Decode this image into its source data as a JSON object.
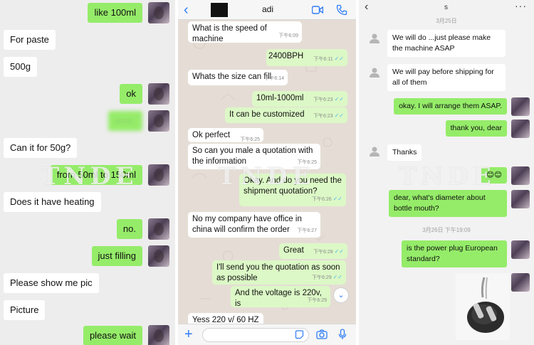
{
  "panel1": {
    "messages": [
      {
        "dir": "out",
        "text": "like 100ml"
      },
      {
        "dir": "in",
        "text": "For paste"
      },
      {
        "dir": "in",
        "text": "500g"
      },
      {
        "dir": "out",
        "text": "ok"
      },
      {
        "dir": "out",
        "text": "——",
        "blurred": true
      },
      {
        "dir": "in",
        "text": "Can it for 50g?"
      },
      {
        "dir": "out",
        "text": "from 50ml to 150ml"
      },
      {
        "dir": "in",
        "text": "Does it have heating"
      },
      {
        "dir": "out",
        "text": "no."
      },
      {
        "dir": "out",
        "text": "just filling"
      },
      {
        "dir": "in",
        "text": "Please show me pic"
      },
      {
        "dir": "in",
        "text": "Picture"
      },
      {
        "dir": "out",
        "text": "please wait"
      }
    ]
  },
  "panel2": {
    "header": {
      "name": "adi"
    },
    "messages": [
      {
        "dir": "in",
        "text": "What is the speed of machine",
        "time": "下午6:09"
      },
      {
        "dir": "out",
        "text": "2400BPH",
        "time": "下午6:11"
      },
      {
        "dir": "in",
        "text": "Whats the size can fill",
        "time": "下午6:14"
      },
      {
        "dir": "out",
        "text": "10ml-1000ml",
        "time": "下午6:23"
      },
      {
        "dir": "out",
        "text": "It can be customized",
        "time": "下午6:23"
      },
      {
        "dir": "in",
        "text": "Ok perfect",
        "time": "下午6:25"
      },
      {
        "dir": "in",
        "text": "So can you male a quotation with the information",
        "time": "下午6:25"
      },
      {
        "dir": "out",
        "text": "Okay. And do you need the shipment quotation?",
        "time": "下午6:26"
      },
      {
        "dir": "in",
        "text": "No my company have office in china will confirm the order",
        "time": "下午6:27"
      },
      {
        "dir": "out",
        "text": "Great",
        "time": "下午6:28"
      },
      {
        "dir": "out",
        "text": "I'll send you the quotation as soon as possible",
        "time": "下午6:29"
      },
      {
        "dir": "out",
        "text": "And the voltage is 220v, is",
        "time": "下午6:29"
      },
      {
        "dir": "in",
        "text": "Yess 220 v/ 60 HZ",
        "time": ""
      }
    ]
  },
  "panel3": {
    "header": {
      "title": "s"
    },
    "stamps": [
      "3月25日",
      "3月26日 下午19:09"
    ],
    "messages": [
      {
        "dir": "in",
        "text": "We will do ...just please make the machine ASAP"
      },
      {
        "dir": "in",
        "text": "We will pay before shipping for all of them"
      },
      {
        "dir": "out",
        "text": "okay. I will arrange them ASAP."
      },
      {
        "dir": "out",
        "text": "thank you, dear"
      },
      {
        "dir": "in",
        "text": "Thanks"
      },
      {
        "dir": "out",
        "text": "😊😊"
      },
      {
        "dir": "out",
        "text": "dear, what's diameter about bottle mouth?"
      },
      {
        "dir": "out",
        "text": "is the power plug European standard?"
      }
    ]
  },
  "watermark": "TNDE",
  "colors": {
    "wechat_green": "#95ec69",
    "whatsapp_green": "#dcf8c6",
    "whatsapp_blue": "#2f7cf6"
  }
}
